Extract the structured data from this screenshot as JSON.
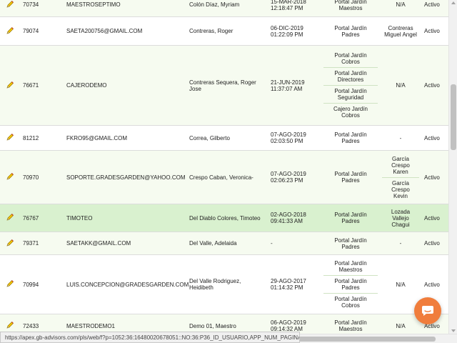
{
  "rows": [
    {
      "id": "70734",
      "user": "MAESTROSEPTIMO",
      "name": "Colón Díaz, Myriam",
      "date": "15-MAR-2018",
      "time": "12:18:47 PM",
      "apps": [
        "Portal Jardín Maestros"
      ],
      "ref": [
        "N/A"
      ],
      "status": "Activo",
      "style": "r-odd"
    },
    {
      "id": "79074",
      "user": "SAETA200756@GMAIL.COM",
      "name": "Contreras, Roger",
      "date": "06-DIC-2019",
      "time": "01:22:09 PM",
      "apps": [
        "Portal Jardín Padres"
      ],
      "ref": [
        "Contreras Miguel Angel"
      ],
      "status": "Activo",
      "style": "r-even"
    },
    {
      "id": "76671",
      "user": "CAJERODEMO",
      "name": "Contreras Sequera, Roger Jose",
      "date": "21-JUN-2019",
      "time": "11:37:07 AM",
      "apps": [
        "Portal Jardín Cobros",
        "Portal Jardín Directores",
        "Portal Jardín Seguridad",
        "Cajero Jardín Cobros"
      ],
      "ref": [
        "N/A"
      ],
      "status": "Activo",
      "style": "r-odd"
    },
    {
      "id": "81212",
      "user": "FKRO95@GMAIL.COM",
      "name": "Correa, Gilberto",
      "date": "07-AGO-2019",
      "time": "02:03:50 PM",
      "apps": [
        "Portal Jardín Padres"
      ],
      "ref": [
        "-"
      ],
      "status": "Activo",
      "style": "r-even"
    },
    {
      "id": "70970",
      "user": "SOPORTE.GRADESGARDEN@YAHOO.COM",
      "name": "Crespo Caban, Veronica-",
      "date": "07-AGO-2019",
      "time": "02:06:23 PM",
      "apps": [
        "Portal Jardín Padres"
      ],
      "ref": [
        "García Crespo Karen",
        "García Crespo Kevin"
      ],
      "status": "Activo",
      "style": "r-odd"
    },
    {
      "id": "76767",
      "user": "TIMOTEO",
      "name": "Del Diablo Colores, Timoteo",
      "date": "02-AGO-2018",
      "time": "09:41:33 AM",
      "apps": [
        "Portal Jardín Padres"
      ],
      "ref": [
        "Lozada Vallejo Chagui"
      ],
      "status": "Activo",
      "style": "r-hl"
    },
    {
      "id": "79371",
      "user": "SAETAKK@GMAIL.COM",
      "name": "Del Valle, Adelaida",
      "date": "-",
      "time": "",
      "apps": [
        "Portal Jardín Padres"
      ],
      "ref": [
        "-"
      ],
      "status": "Activo",
      "style": "r-odd"
    },
    {
      "id": "70994",
      "user": "LUIS.CONCEPCION@GRADESGARDEN.COM",
      "name": "Del Valle Rodriguez, Heidibeth",
      "date": "29-AGO-2017",
      "time": "01:14:32 PM",
      "apps": [
        "Portal Jardín Maestros",
        "Portal Jardín Padres",
        "Portal Jardín Cobros"
      ],
      "ref": [
        "N/A"
      ],
      "status": "Activo",
      "style": "r-even"
    },
    {
      "id": "72433",
      "user": "MAESTRODEMO1",
      "name": "Demo 01, Maestro",
      "date": "06-AGO-2019",
      "time": "09:14:32 AM",
      "apps": [
        "Portal Jardín Maestros"
      ],
      "ref": [
        "N/A"
      ],
      "status": "Activo",
      "style": "r-odd"
    }
  ],
  "status_bar": {
    "url": "https://apex.gb-advisors.com/pls/web/f?p=1052:36:16480020678051::NO:36:P36_ID_USUARIO,APP_NUM_PAGINA:76767,35"
  },
  "colors": {
    "accent": "#f07d3c",
    "highlight_row": "#d9f1cf",
    "odd_row": "#f6fbf0",
    "pencil": "#e0b800"
  },
  "icons": {
    "edit": "pencil-icon",
    "chat": "chat-bubble-icon"
  }
}
